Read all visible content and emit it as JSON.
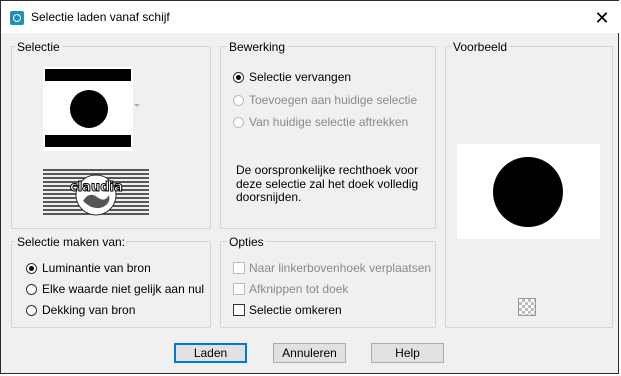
{
  "window": {
    "title": "Selectie laden vanaf schijf",
    "close_glyph": "✕"
  },
  "selectie": {
    "title": "Selectie",
    "watermark": "claudia"
  },
  "bewerking": {
    "title": "Bewerking",
    "options": [
      {
        "label": "Selectie vervangen",
        "checked": true,
        "enabled": true
      },
      {
        "label": "Toevoegen aan huidige selectie",
        "checked": false,
        "enabled": false
      },
      {
        "label": "Van huidige selectie aftrekken",
        "checked": false,
        "enabled": false
      }
    ],
    "info": "De oorspronkelijke rechthoek voor deze selectie zal het doek volledig doorsnijden."
  },
  "voorbeeld": {
    "title": "Voorbeeld"
  },
  "maken_van": {
    "title": "Selectie maken van:",
    "options": [
      {
        "label": "Luminantie van bron",
        "checked": true
      },
      {
        "label": "Elke waarde niet gelijk aan nul",
        "checked": false
      },
      {
        "label": "Dekking van bron",
        "checked": false
      }
    ]
  },
  "opties": {
    "title": "Opties",
    "checks": [
      {
        "label": "Naar linkerbovenhoek verplaatsen",
        "checked": false,
        "enabled": false
      },
      {
        "label": "Afknippen tot doek",
        "checked": false,
        "enabled": false
      },
      {
        "label": "Selectie omkeren",
        "checked": false,
        "enabled": true
      }
    ]
  },
  "buttons": {
    "load": "Laden",
    "cancel": "Annuleren",
    "help": "Help"
  },
  "colors": {
    "dialog_bg": "#f0f0f0",
    "accent": "#0078d7",
    "icon": "#1d8fb8"
  }
}
